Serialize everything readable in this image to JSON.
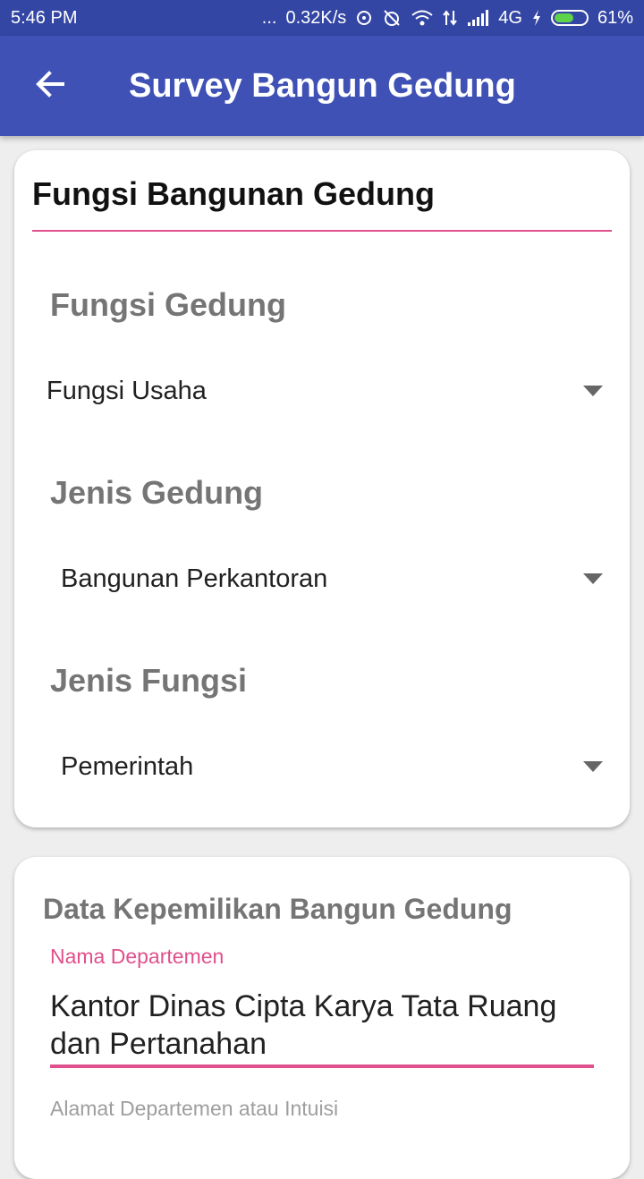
{
  "status_bar": {
    "time": "5:46 PM",
    "dots": "...",
    "speed": "0.32K/s",
    "network": "4G",
    "battery": "61%",
    "battery_level": 0.61
  },
  "app_bar": {
    "title": "Survey Bangun Gedung",
    "back_icon": "arrow-back-icon"
  },
  "card_fungsi": {
    "title": "Fungsi Bangunan Gedung",
    "fields": [
      {
        "label": "Fungsi Gedung",
        "value": "Fungsi Usaha"
      },
      {
        "label": "Jenis Gedung",
        "value": "Bangunan Perkantoran"
      },
      {
        "label": "Jenis Fungsi",
        "value": "Pemerintah"
      }
    ]
  },
  "card_kepemilikan": {
    "title": "Data Kepemilikan Bangun Gedung",
    "nama_label": "Nama Departemen",
    "nama_value": "Kantor Dinas Cipta Karya Tata Ruang dan Pertanahan",
    "alamat_label": "Alamat Departemen atau Intuisi"
  },
  "colors": {
    "primary": "#3f51b5",
    "primary_dark": "#3446a4",
    "accent": "#e0508c"
  }
}
